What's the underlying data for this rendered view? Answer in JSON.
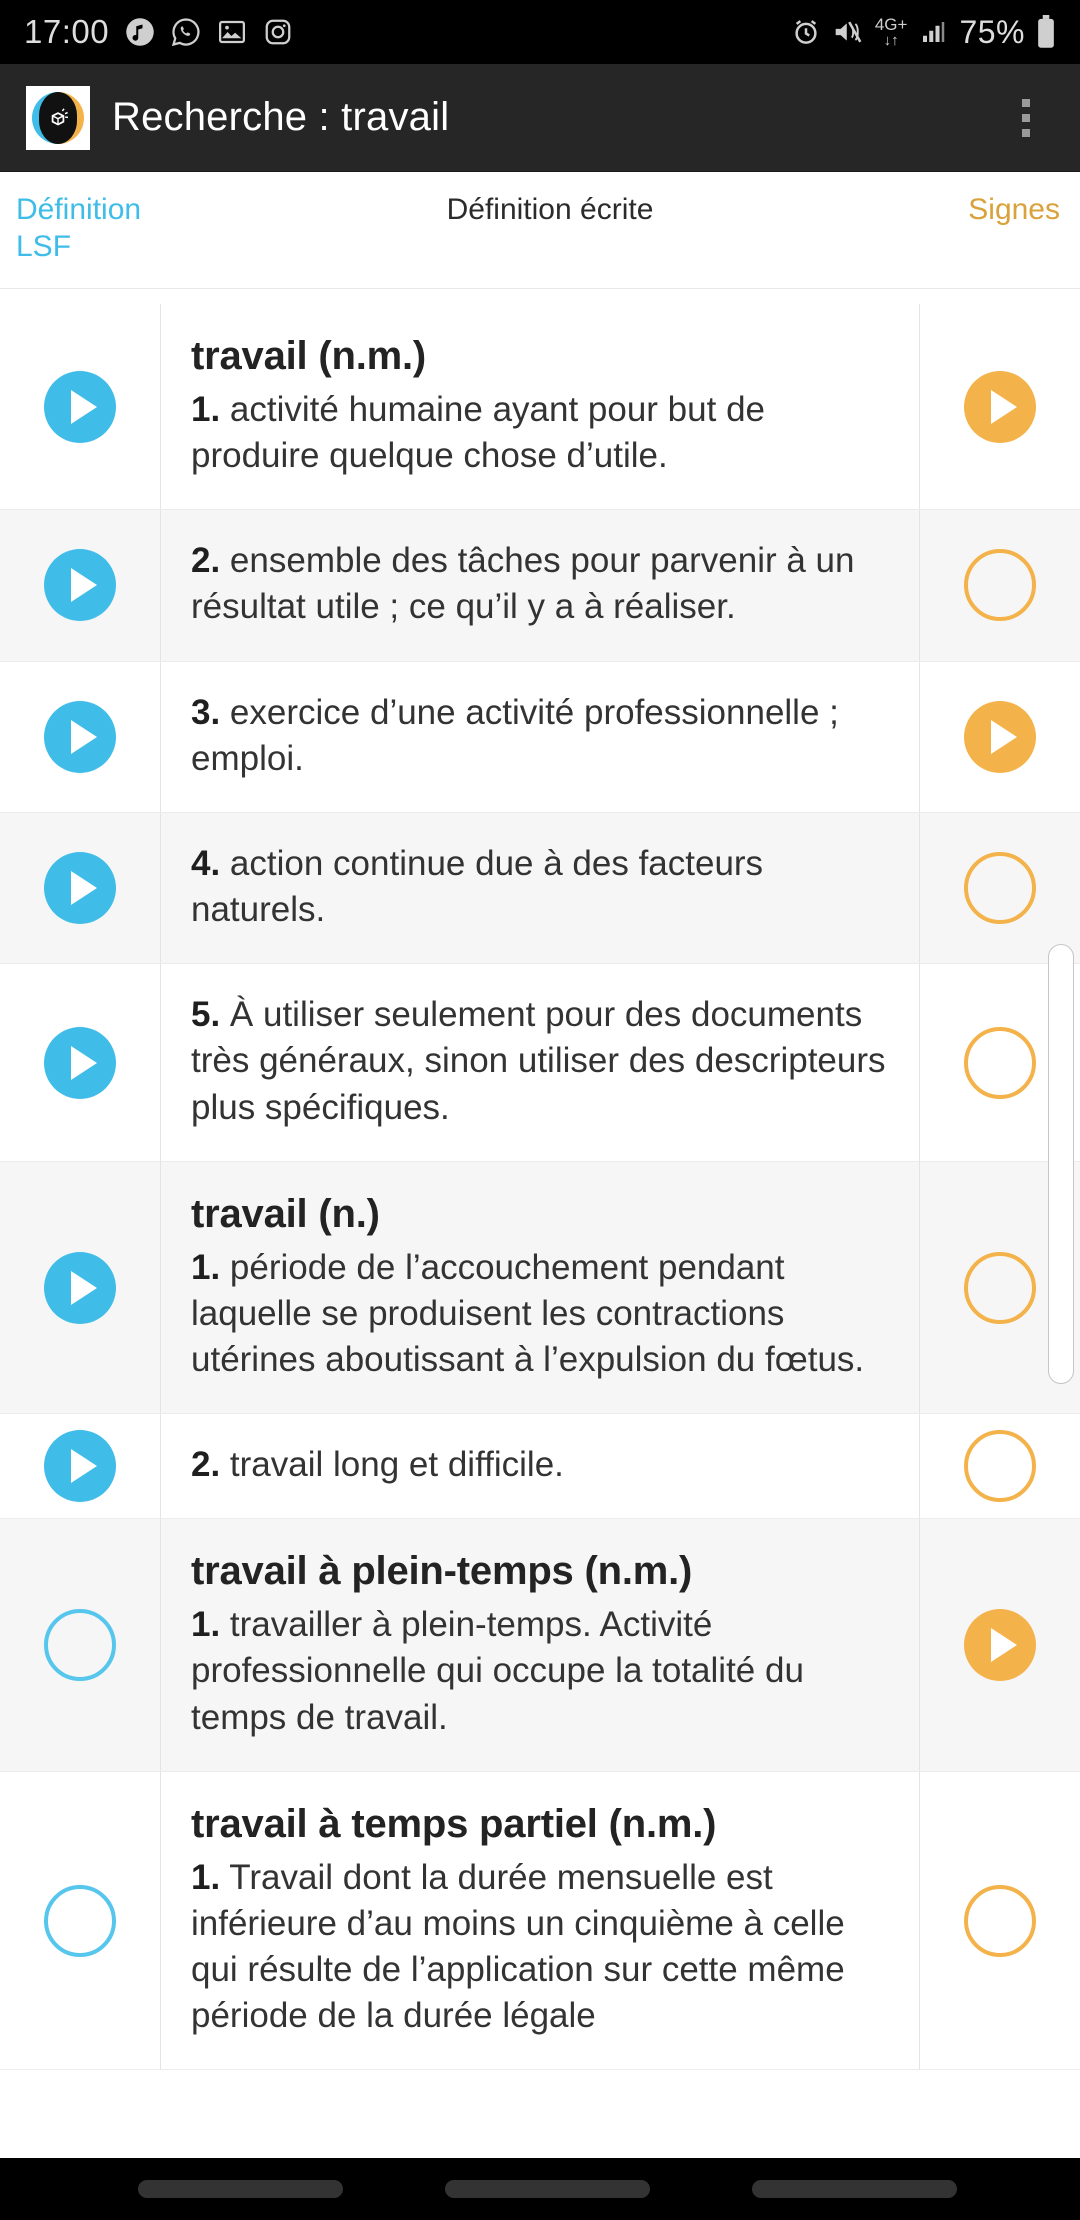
{
  "statusbar": {
    "time": "17:00",
    "left_icons": [
      "music-note-icon",
      "whatsapp-icon",
      "gallery-icon",
      "instagram-icon"
    ],
    "right_icons": [
      "alarm-icon",
      "vibrate-mute-icon"
    ],
    "network_label": "4G+",
    "network_arrows": "↓↑",
    "signal_icon": "signal-bars-icon",
    "battery_percent": "75%",
    "battery_icon": "battery-icon"
  },
  "appbar": {
    "logo_name": "elix-app-logo",
    "title": "Recherche : travail",
    "overflow_label": "overflow-menu"
  },
  "columns": {
    "left": "Définition LSF",
    "left_line1": "Définition",
    "left_line2": "LSF",
    "middle": "Définition écrite",
    "right": "Signes"
  },
  "colors": {
    "blue": "#3FBDE8",
    "orange": "#F4B24A",
    "signs_header": "#D9A23B",
    "appbar_bg": "#262626",
    "alt_row_bg": "#f6f6f6"
  },
  "rows": [
    {
      "alt": false,
      "title": "travail (n.m.)",
      "number": "1.",
      "text": " activité humaine ayant pour but de produire quelque chose d’utile.",
      "lsf_state": "play",
      "signs_state": "play"
    },
    {
      "alt": true,
      "title": "",
      "number": "2.",
      "text": " ensemble des tâches pour parvenir à un résultat utile ; ce qu’il y a à réaliser.",
      "lsf_state": "play",
      "signs_state": "empty"
    },
    {
      "alt": false,
      "title": "",
      "number": "3.",
      "text": " exercice d’une activité professionnelle ; emploi.",
      "lsf_state": "play",
      "signs_state": "play"
    },
    {
      "alt": true,
      "title": "",
      "number": "4.",
      "text": " action continue due à des facteurs naturels.",
      "lsf_state": "play",
      "signs_state": "empty"
    },
    {
      "alt": false,
      "title": "",
      "number": "5.",
      "text": " À utiliser seulement pour des documents très généraux, sinon utiliser des descripteurs plus spécifiques.",
      "lsf_state": "play",
      "signs_state": "empty"
    },
    {
      "alt": true,
      "title": "travail (n.)",
      "number": "1.",
      "text": " période de l’accouchement pendant laquelle se produisent les contractions utérines aboutissant à l’expulsion du fœtus.",
      "lsf_state": "play",
      "signs_state": "empty"
    },
    {
      "alt": false,
      "title": "",
      "number": "2.",
      "text": " travail long et difficile.",
      "lsf_state": "play",
      "signs_state": "empty"
    },
    {
      "alt": true,
      "title": "travail à plein-temps (n.m.)",
      "number": "1.",
      "text": " travailler à plein-temps. Activité professionnelle qui occupe la totalité du temps de travail.",
      "lsf_state": "empty",
      "signs_state": "play"
    },
    {
      "alt": false,
      "title": "travail à temps partiel (n.m.)",
      "number": "1.",
      "text": " Travail dont la durée mensuelle est inférieure d’au moins un cinquième à celle qui résulte de l’application sur cette même période de la durée légale",
      "lsf_state": "empty",
      "signs_state": "empty"
    }
  ],
  "navbar": {
    "recents_label": "recents-button",
    "home_label": "home-button",
    "back_label": "back-button"
  }
}
